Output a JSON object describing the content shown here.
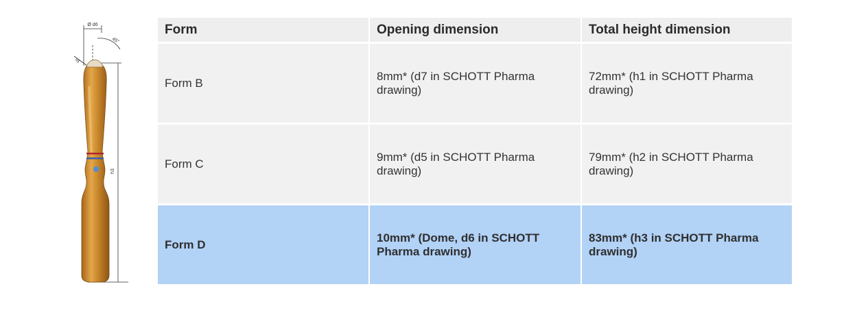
{
  "drawing": {
    "labels": {
      "diameter": "Ø d6",
      "angle": "45°",
      "radius": "h5",
      "height": "h3"
    },
    "colors": {
      "glass_amber": "#c7862a",
      "glass_highlight": "#f0c070",
      "ring_red": "#b0262e",
      "ring_blue": "#3a5fa8",
      "dot_blue": "#4d8fd6"
    }
  },
  "table": {
    "headers": [
      "Form",
      "Opening dimension",
      "Total height dimension"
    ],
    "rows": [
      {
        "form": "Form B",
        "opening": "8mm* (d7 in SCHOTT Pharma drawing)",
        "height": "72mm* (h1 in SCHOTT Pharma drawing)",
        "highlighted": false
      },
      {
        "form": "Form C",
        "opening": "9mm* (d5 in SCHOTT Pharma drawing)",
        "height": "79mm* (h2 in SCHOTT Pharma drawing)",
        "highlighted": false
      },
      {
        "form": "Form D",
        "opening": "10mm* (Dome, d6 in SCHOTT Pharma drawing)",
        "height": "83mm* (h3 in SCHOTT Pharma drawing)",
        "highlighted": true
      }
    ],
    "colors": {
      "cell_bg": "#f1f1f1",
      "highlight_bg": "#b2d2f6"
    }
  }
}
